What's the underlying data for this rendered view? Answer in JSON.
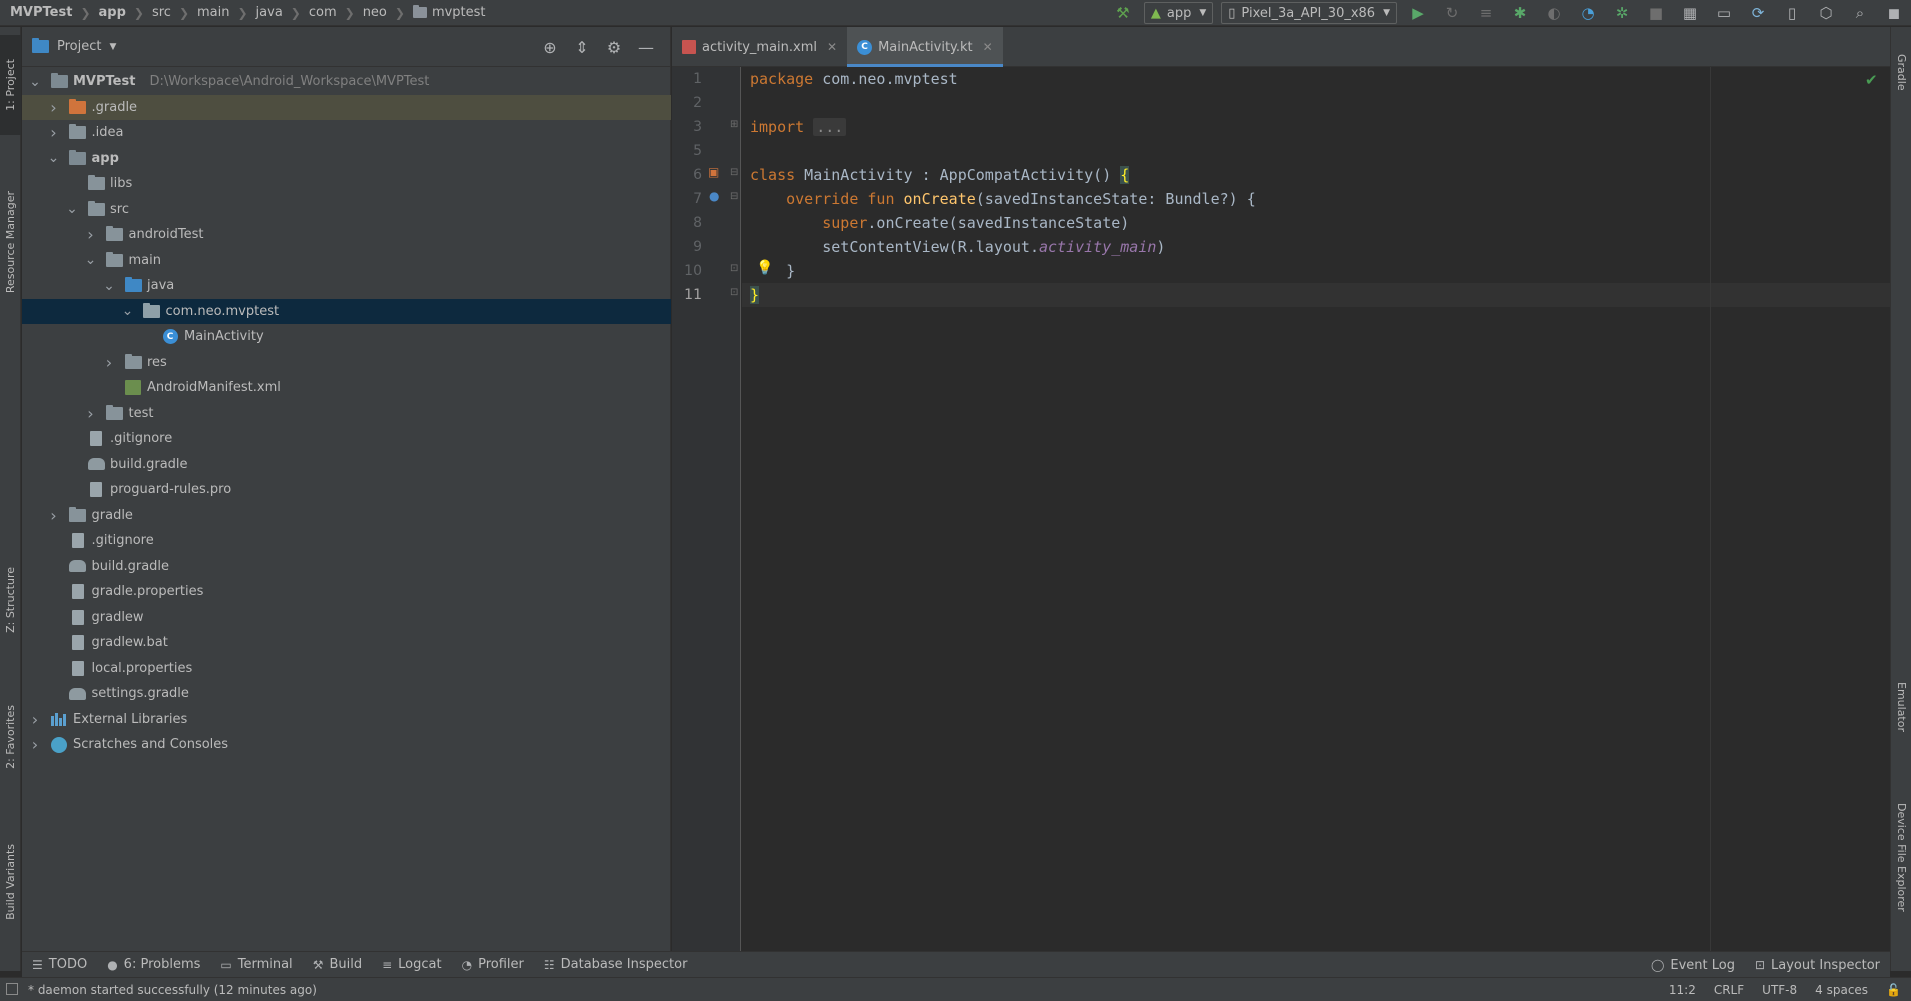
{
  "breadcrumb": [
    {
      "label": "MVPTest",
      "bold": true
    },
    {
      "label": "app",
      "bold": true
    },
    {
      "label": "src"
    },
    {
      "label": "main"
    },
    {
      "label": "java"
    },
    {
      "label": "com"
    },
    {
      "label": "neo"
    },
    {
      "label": "mvptest",
      "folder": true
    }
  ],
  "toolbar": {
    "run_config": "app",
    "device": "Pixel_3a_API_30_x86",
    "icons": [
      "hammer-icon",
      "run-icon",
      "rerun-icon",
      "coverage-icon",
      "debug-icon",
      "attach-icon",
      "profile-icon",
      "apply-changes-icon",
      "stop-icon",
      "project-structure-icon",
      "terminal-icon",
      "sync-icon",
      "avd-icon",
      "sdk-icon",
      "search-icon",
      "user-icon"
    ]
  },
  "left_strip": {
    "project": "1: Project",
    "resource_manager": "Resource Manager",
    "structure": "Z: Structure",
    "favorites": "2: Favorites",
    "build_variants": "Build Variants"
  },
  "right_strip": {
    "gradle": "Gradle",
    "emulator": "Emulator",
    "device_file_explorer": "Device File Explorer"
  },
  "project_panel": {
    "title": "Project",
    "header_icons": [
      "locate-icon",
      "collapse-icon",
      "settings-icon",
      "hide-icon"
    ],
    "tree": [
      {
        "label": "MVPTest",
        "path": "D:\\Workspace\\Android_Workspace\\MVPTest",
        "depth": 0,
        "chev": "down",
        "icon": "module"
      },
      {
        "label": ".gradle",
        "depth": 1,
        "chev": "right",
        "icon": "folder-orange",
        "highlight": true
      },
      {
        "label": ".idea",
        "depth": 1,
        "chev": "right",
        "icon": "folder"
      },
      {
        "label": "app",
        "depth": 1,
        "chev": "down",
        "icon": "module"
      },
      {
        "label": "libs",
        "depth": 2,
        "icon": "folder"
      },
      {
        "label": "src",
        "depth": 2,
        "chev": "down",
        "icon": "folder"
      },
      {
        "label": "androidTest",
        "depth": 3,
        "chev": "right",
        "icon": "folder"
      },
      {
        "label": "main",
        "depth": 3,
        "chev": "down",
        "icon": "folder"
      },
      {
        "label": "java",
        "depth": 4,
        "chev": "down",
        "icon": "folder-blue"
      },
      {
        "label": "com.neo.mvptest",
        "depth": 5,
        "chev": "down",
        "icon": "package",
        "selected": true
      },
      {
        "label": "MainActivity",
        "depth": 6,
        "icon": "kotlin"
      },
      {
        "label": "res",
        "depth": 4,
        "chev": "right",
        "icon": "folder"
      },
      {
        "label": "AndroidManifest.xml",
        "depth": 4,
        "icon": "xml"
      },
      {
        "label": "test",
        "depth": 3,
        "chev": "right",
        "icon": "folder"
      },
      {
        "label": ".gitignore",
        "depth": 2,
        "icon": "file"
      },
      {
        "label": "build.gradle",
        "depth": 2,
        "icon": "gradle"
      },
      {
        "label": "proguard-rules.pro",
        "depth": 2,
        "icon": "file"
      },
      {
        "label": "gradle",
        "depth": 1,
        "chev": "right",
        "icon": "folder"
      },
      {
        "label": ".gitignore",
        "depth": 1,
        "icon": "file"
      },
      {
        "label": "build.gradle",
        "depth": 1,
        "icon": "gradle"
      },
      {
        "label": "gradle.properties",
        "depth": 1,
        "icon": "file"
      },
      {
        "label": "gradlew",
        "depth": 1,
        "icon": "file"
      },
      {
        "label": "gradlew.bat",
        "depth": 1,
        "icon": "file"
      },
      {
        "label": "local.properties",
        "depth": 1,
        "icon": "file"
      },
      {
        "label": "settings.gradle",
        "depth": 1,
        "icon": "gradle"
      },
      {
        "label": "External Libraries",
        "depth": 0,
        "chev": "right",
        "icon": "libraries"
      },
      {
        "label": "Scratches and Consoles",
        "depth": 0,
        "chev": "right",
        "icon": "scratches"
      }
    ]
  },
  "editor": {
    "tabs": [
      {
        "label": "activity_main.xml",
        "active": false
      },
      {
        "label": "MainActivity.kt",
        "active": true
      }
    ],
    "line_numbers": [
      "1",
      "2",
      "3",
      "5",
      "6",
      "7",
      "8",
      "9",
      "10",
      "11"
    ],
    "current_line": "11",
    "code": {
      "l1_kw": "package",
      "l1_rest": " com.neo.mvptest",
      "l3_kw": "import",
      "l3_fold": "...",
      "l6_kw": "class",
      "l6_rest": " MainActivity : AppCompatActivity() ",
      "l6_brace": "{",
      "l7_indent": "    ",
      "l7_kw": "override fun",
      "l7_fn": " onCreate",
      "l7_rest": "(savedInstanceState: Bundle?) {",
      "l8_indent": "        ",
      "l8_kw": "super",
      "l8_rest": ".onCreate(savedInstanceState)",
      "l9_indent": "        ",
      "l9_rest": "setContentView(R.layout.",
      "l9_it": "activity_main",
      "l9_end": ")",
      "l10": "    }",
      "l11": "}"
    }
  },
  "bottom_tabs": {
    "left": [
      {
        "label": "TODO",
        "icon": "list-icon"
      },
      {
        "label": "6: Problems",
        "icon": "info-icon"
      },
      {
        "label": "Terminal",
        "icon": "terminal-icon"
      },
      {
        "label": "Build",
        "icon": "hammer-icon"
      },
      {
        "label": "Logcat",
        "icon": "logcat-icon"
      },
      {
        "label": "Profiler",
        "icon": "profiler-icon"
      },
      {
        "label": "Database Inspector",
        "icon": "database-icon"
      }
    ],
    "right": [
      {
        "label": "Event Log",
        "icon": "event-log-icon"
      },
      {
        "label": "Layout Inspector",
        "icon": "layout-inspector-icon"
      }
    ]
  },
  "status_bar": {
    "message": "* daemon started successfully (12 minutes ago)",
    "position": "11:2",
    "line_sep": "CRLF",
    "encoding": "UTF-8",
    "indent": "4 spaces"
  }
}
